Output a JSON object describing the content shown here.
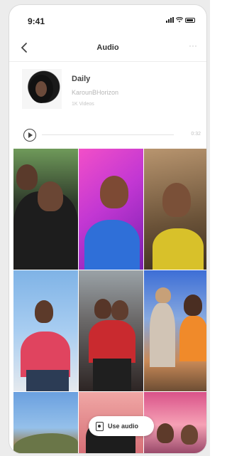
{
  "status_bar": {
    "time": "9:41"
  },
  "nav": {
    "title": "Audio",
    "more": "···"
  },
  "audio": {
    "title": "Daily",
    "artist": "KarounBHorizon",
    "count": "1K Videos",
    "duration": "0:32"
  },
  "grid": {
    "tiles": [
      "video-1",
      "video-2",
      "video-3",
      "video-4",
      "video-5",
      "video-6",
      "video-7",
      "video-8",
      "video-9"
    ]
  },
  "action": {
    "use_audio": "Use audio"
  }
}
